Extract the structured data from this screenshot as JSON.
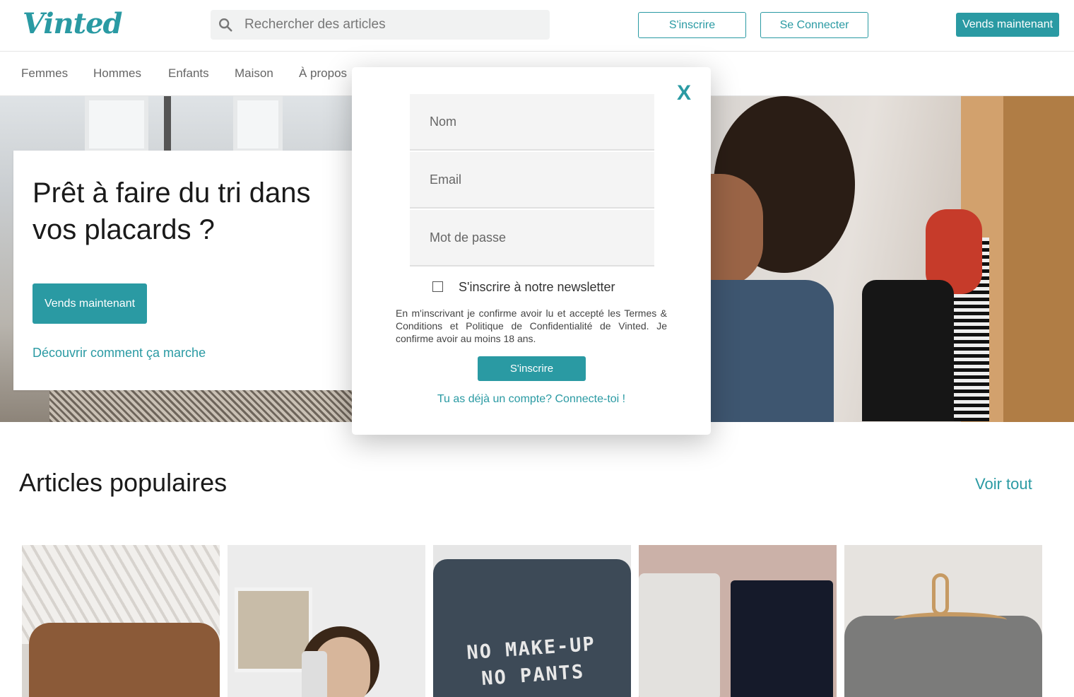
{
  "header": {
    "logo": "Vinted",
    "search_placeholder": "Rechercher des articles",
    "signup_label": "S'inscrire",
    "login_label": "Se Connecter",
    "sell_label": "Vends maintenant"
  },
  "nav": {
    "items": [
      "Femmes",
      "Hommes",
      "Enfants",
      "Maison",
      "À propos"
    ]
  },
  "hero": {
    "title": "Prêt à faire du tri dans vos placards ?",
    "sell_label": "Vends maintenant",
    "link_label": "Découvrir comment ça marche"
  },
  "popular": {
    "title": "Articles populaires",
    "see_all": "Voir tout",
    "cards": [
      {
        "name": "brown-suede-bag"
      },
      {
        "name": "woman-selfie"
      },
      {
        "name": "grey-tshirt",
        "print": "NO MAKE-UP\nNO PANTS"
      },
      {
        "name": "white-and-black-pants"
      },
      {
        "name": "grey-sweater-on-hanger"
      }
    ]
  },
  "modal": {
    "close_label": "X",
    "name_placeholder": "Nom",
    "email_placeholder": "Email",
    "password_placeholder": "Mot de passe",
    "newsletter_label": "S'inscrire à notre newsletter",
    "terms_text": "En m'inscrivant je confirme avoir lu et accepté les Termes & Conditions et Politique de Confidentialité de Vinted. Je confirme avoir au moins 18 ans.",
    "signup_label": "S'inscrire",
    "login_link": "Tu as déjà un compte? Connecte-toi !"
  },
  "colors": {
    "accent": "#2a9aa3"
  }
}
